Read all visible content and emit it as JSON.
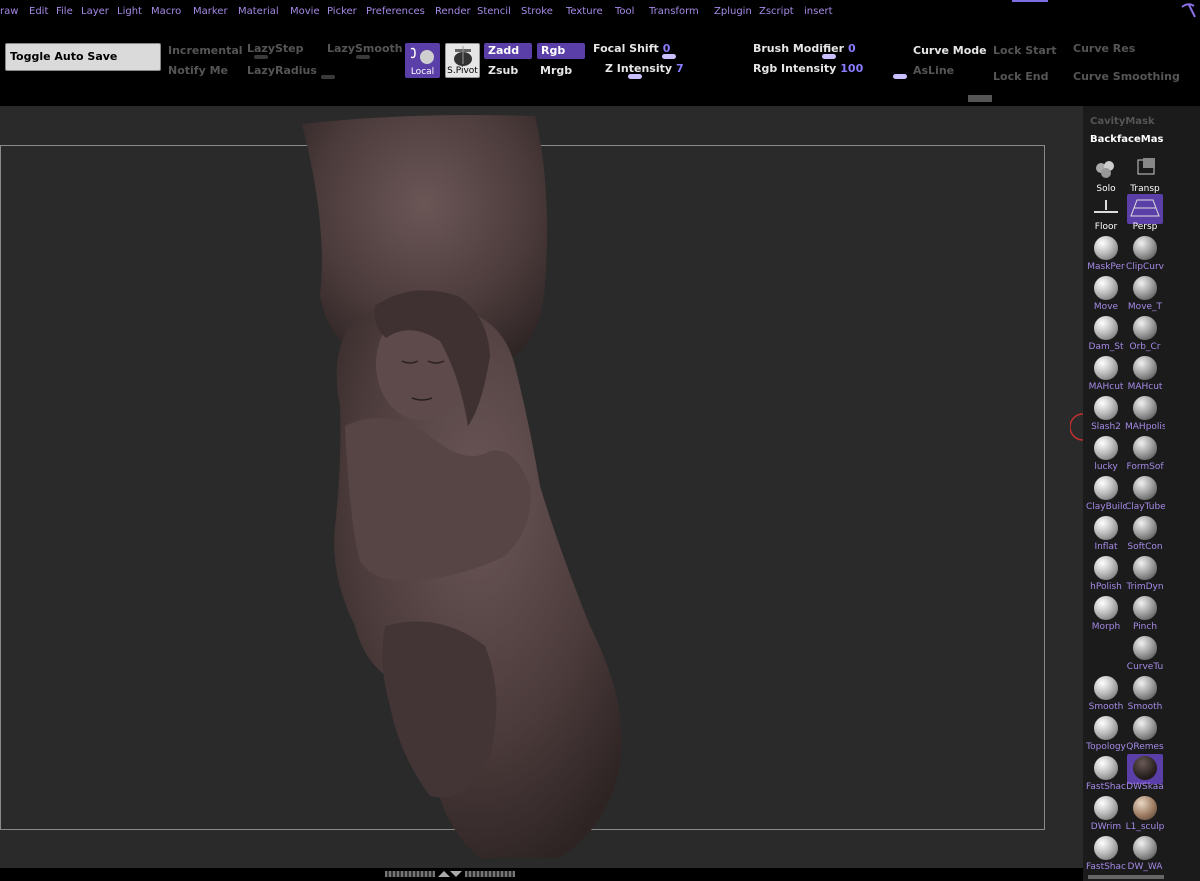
{
  "menu": {
    "items": [
      "raw",
      "Edit",
      "File",
      "Layer",
      "Light",
      "Macro",
      "Marker",
      "Material",
      "Movie",
      "Picker",
      "Preferences",
      "Render",
      "Stencil",
      "Stroke",
      "Texture",
      "Tool",
      "Transform",
      "Zplugin",
      "Zscript",
      "insert"
    ]
  },
  "toolbar": {
    "toggle_auto_save": "Toggle Auto Save",
    "incremental": "Incremental",
    "notify_me": "Notify Me",
    "lazy_step": "LazyStep",
    "lazy_radius": "LazyRadius",
    "lazy_smooth": "LazySmooth",
    "local": "Local",
    "s_pivot": "S.Pivot",
    "zadd": "Zadd",
    "zsub": "Zsub",
    "rgb": "Rgb",
    "mrgb": "Mrgb",
    "focal_shift_label": "Focal Shift",
    "focal_shift_value": "0",
    "z_intensity_label": "Z Intensity",
    "z_intensity_value": "7",
    "brush_modifier_label": "Brush Modifier",
    "brush_modifier_value": "0",
    "rgb_intensity_label": "Rgb Intensity",
    "rgb_intensity_value": "100",
    "curve_mode": "Curve Mode",
    "asline": "AsLine",
    "lock_start": "Lock Start",
    "lock_end": "Lock End",
    "curve_res": "Curve Res",
    "curve_smoothing": "Curve Smoothing"
  },
  "shelf": {
    "cavity_mask": "CavityMask",
    "backface_mask": "BackfaceMas",
    "solo": "Solo",
    "transp": "Transp",
    "floor": "Floor",
    "persp": "Persp",
    "brushes": [
      "MaskPer",
      "ClipCurv",
      "Move",
      "Move_T",
      "Dam_St",
      "Orb_Cr",
      "MAHcut",
      "MAHcut",
      "Slash2",
      "MAHpolis",
      "lucky",
      "FormSof",
      "ClayBuilc",
      "ClayTube",
      "Inflat",
      "SoftCon",
      "hPolish",
      "TrimDyn",
      "Morph",
      "Pinch",
      "CurveTu",
      "Smooth",
      "Smooth",
      "Topology",
      "QRemes",
      "FastShac",
      "DWSkaa",
      "DWrim",
      "L1_sculp",
      "FastShac",
      "DW_WA"
    ]
  },
  "colors": {
    "menu_text": "#a58ae6",
    "accent_value": "#8a7cff",
    "selected_bg": "#5b3fa8",
    "viewport_bg": "#2a2a2a",
    "sculpt": "#4d3c3c"
  },
  "icons": {
    "pickaxe": "pickaxe-icon",
    "local": "local-symmetry-icon",
    "s_pivot": "pivot-icon"
  }
}
